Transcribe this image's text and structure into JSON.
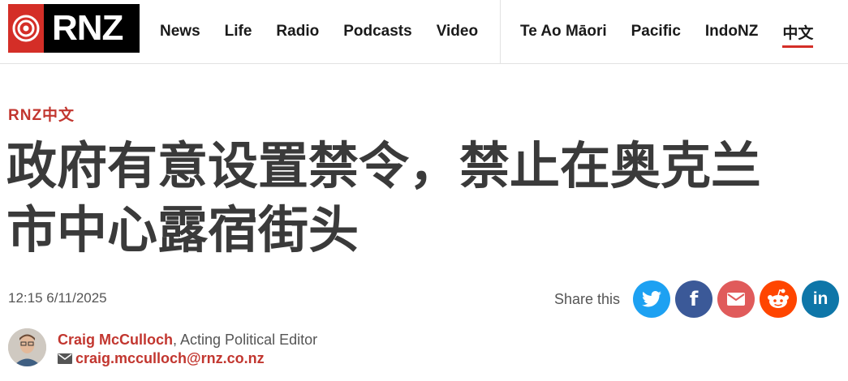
{
  "header": {
    "logo_text": "RNZ",
    "nav_main": [
      {
        "label": "News"
      },
      {
        "label": "Life"
      },
      {
        "label": "Radio"
      },
      {
        "label": "Podcasts"
      },
      {
        "label": "Video"
      }
    ],
    "nav_secondary": [
      {
        "label": "Te Ao Māori"
      },
      {
        "label": "Pacific"
      },
      {
        "label": "IndoNZ"
      },
      {
        "label": "中文",
        "active": true
      }
    ]
  },
  "article": {
    "section": "RNZ中文",
    "headline_line1": "政府有意设置禁令，禁止在奥克兰",
    "headline_line2": "市中心露宿街头",
    "timestamp": "12:15 6/11/2025"
  },
  "share": {
    "label": "Share this",
    "buttons": [
      {
        "name": "twitter",
        "icon": "twitter-icon",
        "color": "#1da1f2"
      },
      {
        "name": "facebook",
        "icon": "facebook-icon",
        "color": "#3b5998",
        "glyph": "f"
      },
      {
        "name": "email",
        "icon": "email-icon",
        "color": "#e05b5b"
      },
      {
        "name": "reddit",
        "icon": "reddit-icon",
        "color": "#ff4500"
      },
      {
        "name": "linkedin",
        "icon": "linkedin-icon",
        "color": "#0e76a8",
        "glyph": "in"
      }
    ]
  },
  "author": {
    "name": "Craig McCulloch",
    "role": ", Acting Political Editor",
    "email": "craig.mcculloch@rnz.co.nz"
  },
  "colors": {
    "brand_red": "#d42e27",
    "link_red": "#c2362f"
  }
}
